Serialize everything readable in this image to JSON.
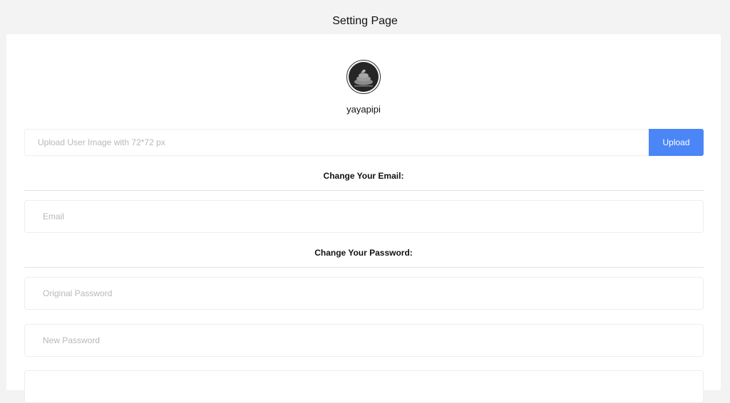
{
  "page": {
    "title": "Setting Page"
  },
  "profile": {
    "avatar_icon": "poop-avatar-icon",
    "username": "yayapipi"
  },
  "upload": {
    "value": "",
    "placeholder": "Upload User Image with 72*72 px",
    "button_label": "Upload",
    "button_color": "#4b86f7"
  },
  "email_section": {
    "heading": "Change Your Email:",
    "email": {
      "value": "",
      "placeholder": "Email"
    }
  },
  "password_section": {
    "heading": "Change Your Password:",
    "original_password": {
      "value": "",
      "placeholder": "Original Password"
    },
    "new_password": {
      "value": "",
      "placeholder": "New Password"
    },
    "confirm_password": {
      "value": "",
      "placeholder": ""
    }
  }
}
